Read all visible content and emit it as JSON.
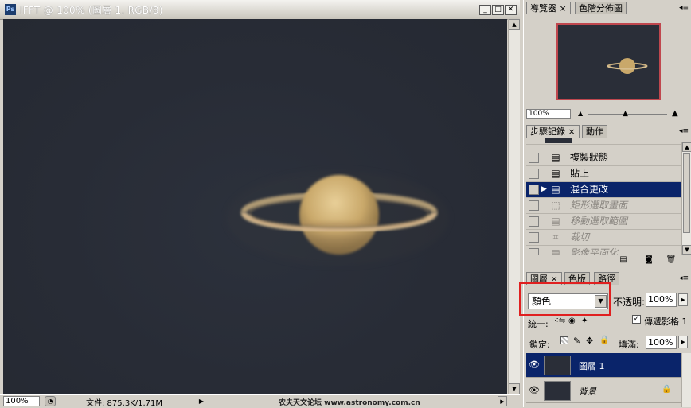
{
  "document": {
    "title": "IFFT @ 100% (圖層 1, RGB/8)",
    "buttons": {
      "minimize": "_",
      "restore": "□",
      "close": "✕"
    },
    "status": {
      "zoom": "100%",
      "file_info": "文件: 875.3K/1.71M",
      "watermark": "农夫天文论坛 www.astronomy.com.cn"
    }
  },
  "navigator": {
    "tabs": [
      {
        "label": "導覽器 ×",
        "active": true
      },
      {
        "label": "色階分佈圖",
        "active": false
      }
    ],
    "zoom": "100%"
  },
  "history": {
    "tabs": [
      {
        "label": "步驟記錄 ×",
        "active": true
      },
      {
        "label": "動作",
        "active": false
      }
    ],
    "items": [
      {
        "label": "複製狀態",
        "icon": "page-icon",
        "state": "normal"
      },
      {
        "label": "貼上",
        "icon": "page-icon",
        "state": "normal"
      },
      {
        "label": "混合更改",
        "icon": "page-icon",
        "state": "selected"
      },
      {
        "label": "矩形選取畫面",
        "icon": "marquee-icon",
        "state": "dimmed"
      },
      {
        "label": "移動選取範圍",
        "icon": "page-icon",
        "state": "dimmed"
      },
      {
        "label": "裁切",
        "icon": "crop-icon",
        "state": "dimmed"
      },
      {
        "label": "影像平面化",
        "icon": "page-icon",
        "state": "dimmed"
      }
    ]
  },
  "layers": {
    "tabs": [
      {
        "label": "圖層 ×",
        "active": true
      },
      {
        "label": "色版",
        "active": false
      },
      {
        "label": "路徑",
        "active": false
      }
    ],
    "blend_mode": "顏色",
    "opacity_label": "不透明:",
    "opacity_value": "100%",
    "unify_label": "統一:",
    "propagate_label": "傳遞影格 1",
    "propagate_checked": true,
    "lock_label": "鎖定:",
    "fill_label": "填滿:",
    "fill_value": "100%",
    "items": [
      {
        "name": "圖層 1",
        "selected": true,
        "locked": false
      },
      {
        "name": "背景",
        "selected": false,
        "locked": true
      }
    ]
  },
  "colors": {
    "selection": "#0a246a",
    "highlight_box": "#e02020",
    "panel_bg": "#d4d0c8"
  }
}
